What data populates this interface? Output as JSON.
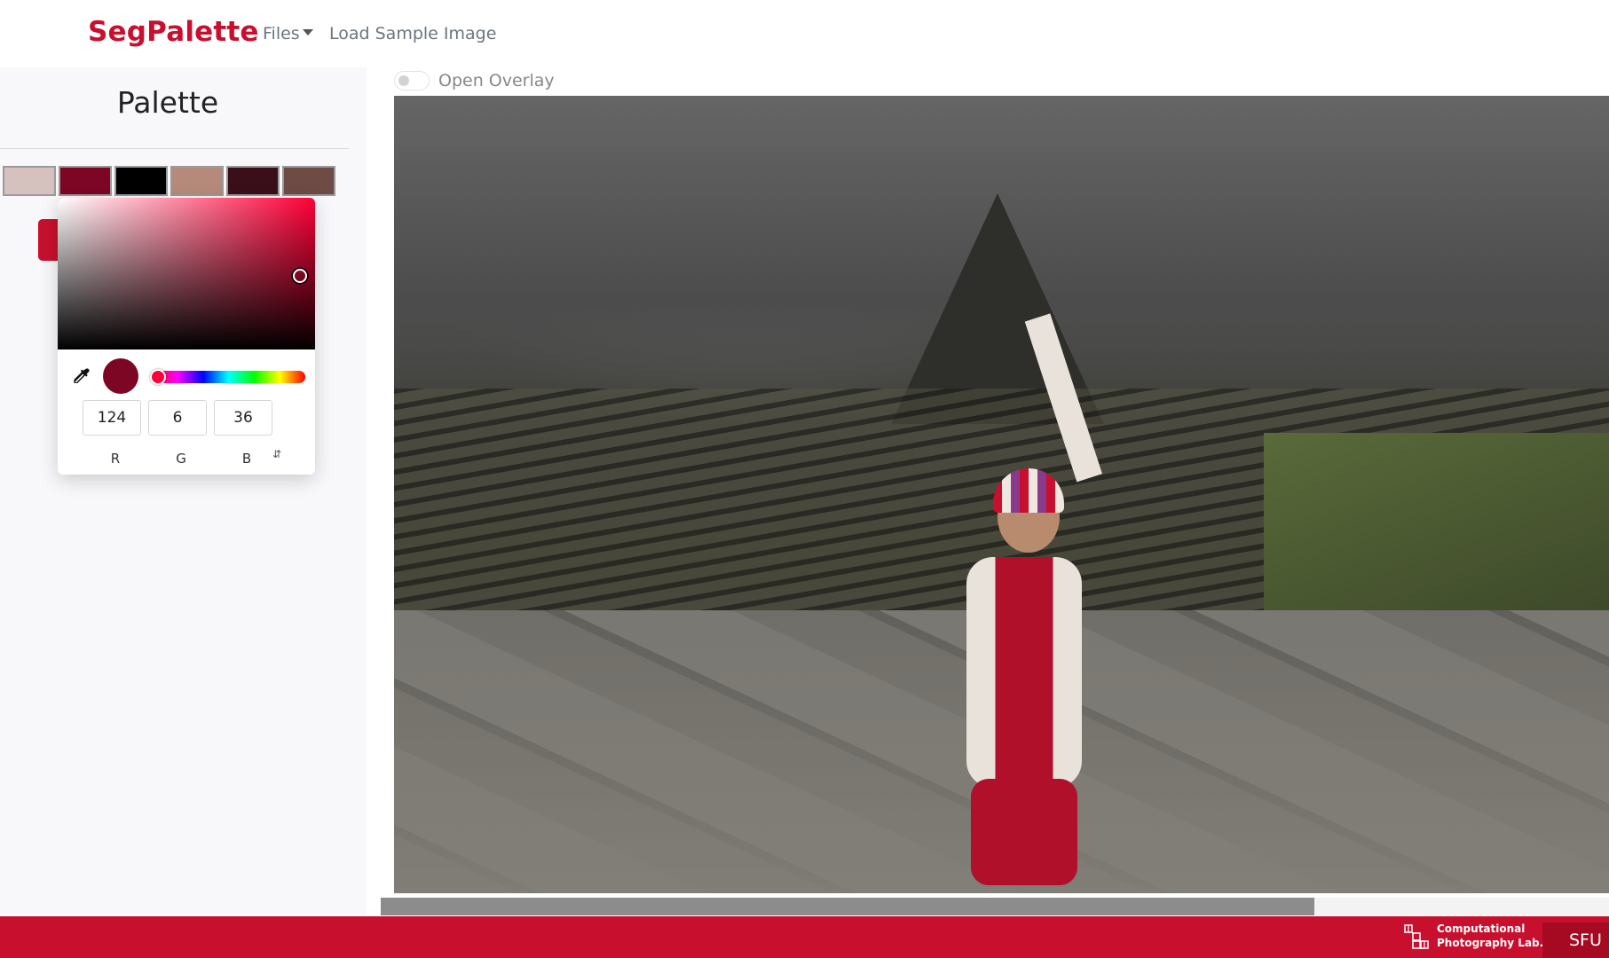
{
  "navbar": {
    "brand": "SegPalette",
    "files_label": "Files",
    "load_sample_label": "Load Sample Image"
  },
  "sidebar": {
    "title": "Palette",
    "swatches": [
      "#d5c1bd",
      "#7c0624",
      "#000000",
      "#b58a7a",
      "#3b0f1a",
      "#6e4b45"
    ]
  },
  "picker": {
    "hue_color": "#ff0037",
    "selected_color": "#7c0624",
    "r": "124",
    "g": "6",
    "b": "36",
    "r_label": "R",
    "g_label": "G",
    "b_label": "B",
    "mode_toggle_icon": "up-down-arrows-icon",
    "eyedropper_icon": "eyedropper-icon"
  },
  "main": {
    "overlay_label": "Open Overlay",
    "overlay_on": false,
    "scroll_position": 0.76
  },
  "footer": {
    "lab_line1": "Computational",
    "lab_line2": "Photography Lab.",
    "university": "SFU",
    "accent": "#c8102e"
  }
}
